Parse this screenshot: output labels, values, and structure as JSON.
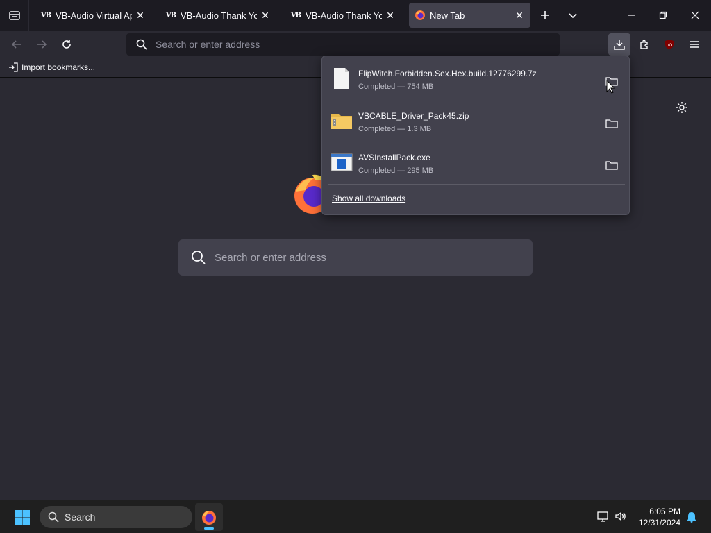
{
  "tabs": [
    {
      "favicon": "VB",
      "title": "VB-Audio Virtual Apps",
      "active": false
    },
    {
      "favicon": "VB",
      "title": "VB-Audio Thank You P",
      "active": false
    },
    {
      "favicon": "VB",
      "title": "VB-Audio Thank You P",
      "active": false
    },
    {
      "favicon": "firefox-icon",
      "title": "New Tab",
      "active": true
    }
  ],
  "toolbar": {
    "url_placeholder": "Search or enter address",
    "bookmark_import": "Import bookmarks..."
  },
  "newtab": {
    "search_placeholder": "Search or enter address"
  },
  "downloads": {
    "items": [
      {
        "name": "FlipWitch.Forbidden.Sex.Hex.build.12776299.7z",
        "status": "Completed — 754 MB",
        "icon": "file-icon"
      },
      {
        "name": "VBCABLE_Driver_Pack45.zip",
        "status": "Completed — 1.3 MB",
        "icon": "zip-folder-icon"
      },
      {
        "name": "AVSInstallPack.exe",
        "status": "Completed — 295 MB",
        "icon": "exe-icon"
      }
    ],
    "show_all": "Show all downloads"
  },
  "taskbar": {
    "search_label": "Search",
    "time": "6:05 PM",
    "date": "12/31/2024"
  },
  "colors": {
    "accent": "#4cc2ff",
    "panel": "#42414d",
    "background": "#2b2a33"
  }
}
